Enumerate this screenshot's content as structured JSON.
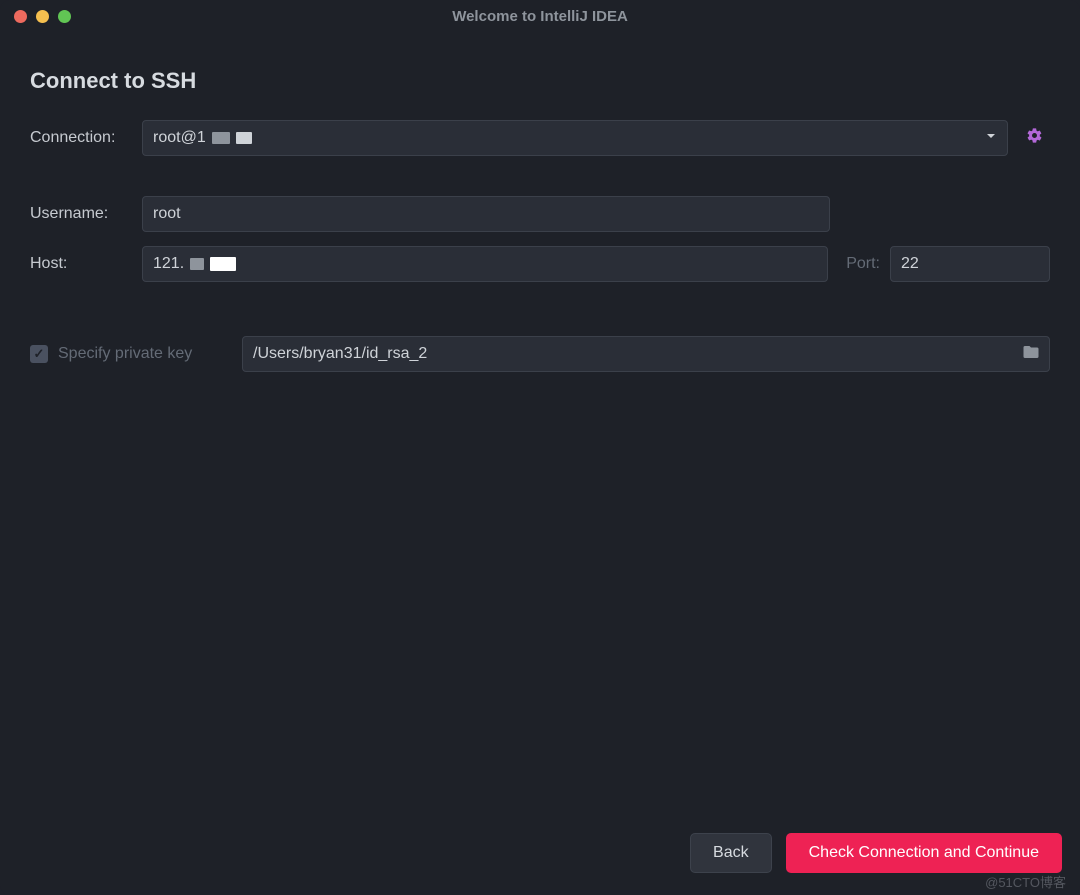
{
  "window": {
    "title": "Welcome to IntelliJ IDEA"
  },
  "page": {
    "heading": "Connect to SSH"
  },
  "form": {
    "connection_label": "Connection:",
    "connection_value_prefix": "root@1",
    "username_label": "Username:",
    "username_value": "root",
    "host_label": "Host:",
    "host_value_prefix": "121.",
    "port_label": "Port:",
    "port_value": "22",
    "private_key_label": "Specify private key",
    "private_key_checked": true,
    "private_key_path": "/Users/bryan31/id_rsa_2"
  },
  "buttons": {
    "back": "Back",
    "continue": "Check Connection and Continue"
  },
  "watermark": "@51CTO博客"
}
